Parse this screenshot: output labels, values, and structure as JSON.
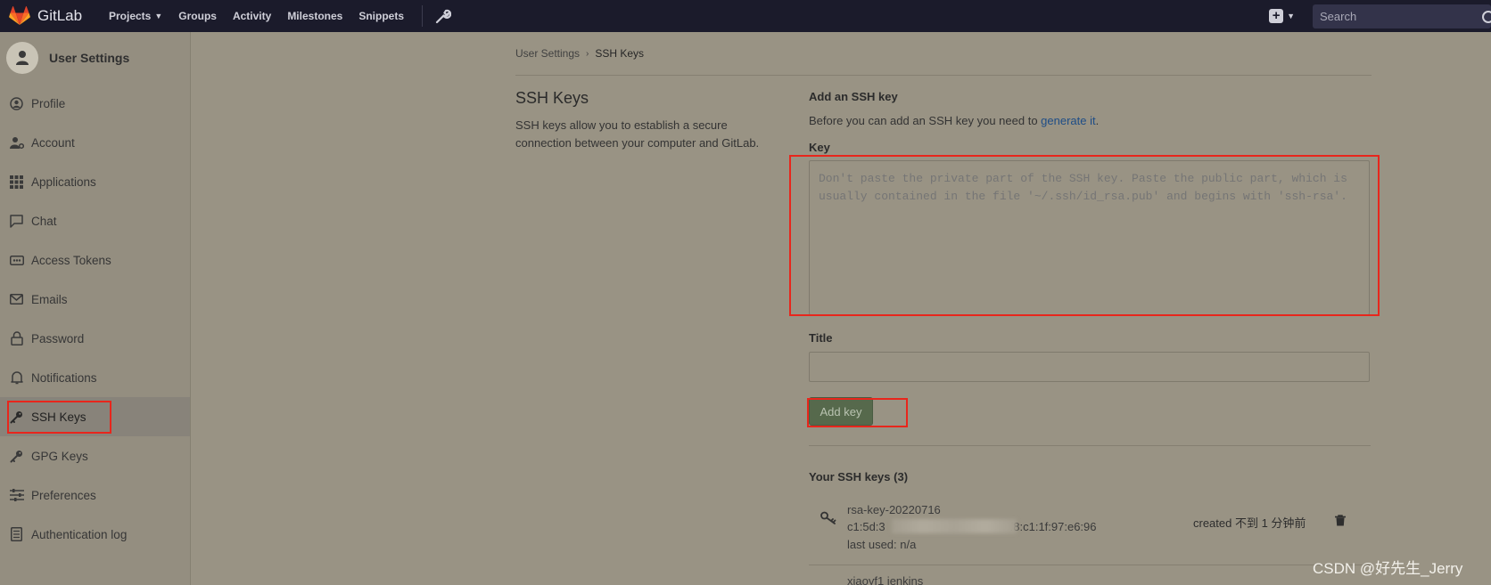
{
  "app": {
    "brand": "GitLab"
  },
  "nav": {
    "links": [
      "Projects",
      "Groups",
      "Activity",
      "Milestones",
      "Snippets"
    ],
    "search_placeholder": "Search"
  },
  "sidebar": {
    "title": "User Settings",
    "items": [
      {
        "label": "Profile",
        "icon": "profile-icon"
      },
      {
        "label": "Account",
        "icon": "account-icon"
      },
      {
        "label": "Applications",
        "icon": "applications-icon"
      },
      {
        "label": "Chat",
        "icon": "chat-icon"
      },
      {
        "label": "Access Tokens",
        "icon": "token-icon"
      },
      {
        "label": "Emails",
        "icon": "email-icon"
      },
      {
        "label": "Password",
        "icon": "lock-icon"
      },
      {
        "label": "Notifications",
        "icon": "bell-icon"
      },
      {
        "label": "SSH Keys",
        "icon": "key-icon",
        "active": true
      },
      {
        "label": "GPG Keys",
        "icon": "key-icon"
      },
      {
        "label": "Preferences",
        "icon": "sliders-icon"
      },
      {
        "label": "Authentication log",
        "icon": "log-icon"
      }
    ]
  },
  "breadcrumb": {
    "parent": "User Settings",
    "current": "SSH Keys"
  },
  "section": {
    "title": "SSH Keys",
    "description": "SSH keys allow you to establish a secure connection between your computer and GitLab."
  },
  "form": {
    "heading": "Add an SSH key",
    "help_prefix": "Before you can add an SSH key you need to ",
    "help_link": "generate it",
    "help_suffix": ".",
    "key_label": "Key",
    "key_placeholder": "Don't paste the private part of the SSH key. Paste the public part, which is usually contained in the file '~/.ssh/id_rsa.pub' and begins with 'ssh-rsa'.",
    "title_label": "Title",
    "title_value": "",
    "submit": "Add key"
  },
  "keys": {
    "heading": "Your SSH keys (3)",
    "list": [
      {
        "name": "rsa-key-20220716",
        "fingerprint_start": "c1:5d:3",
        "fingerprint_end": "f8:c1:1f:97:e6:96",
        "last_used": "last used: n/a",
        "created": "created 不到 1 分钟前"
      },
      {
        "name": "xiaoyf1 jenkins"
      }
    ]
  },
  "watermark": "CSDN @好先生_Jerry"
}
